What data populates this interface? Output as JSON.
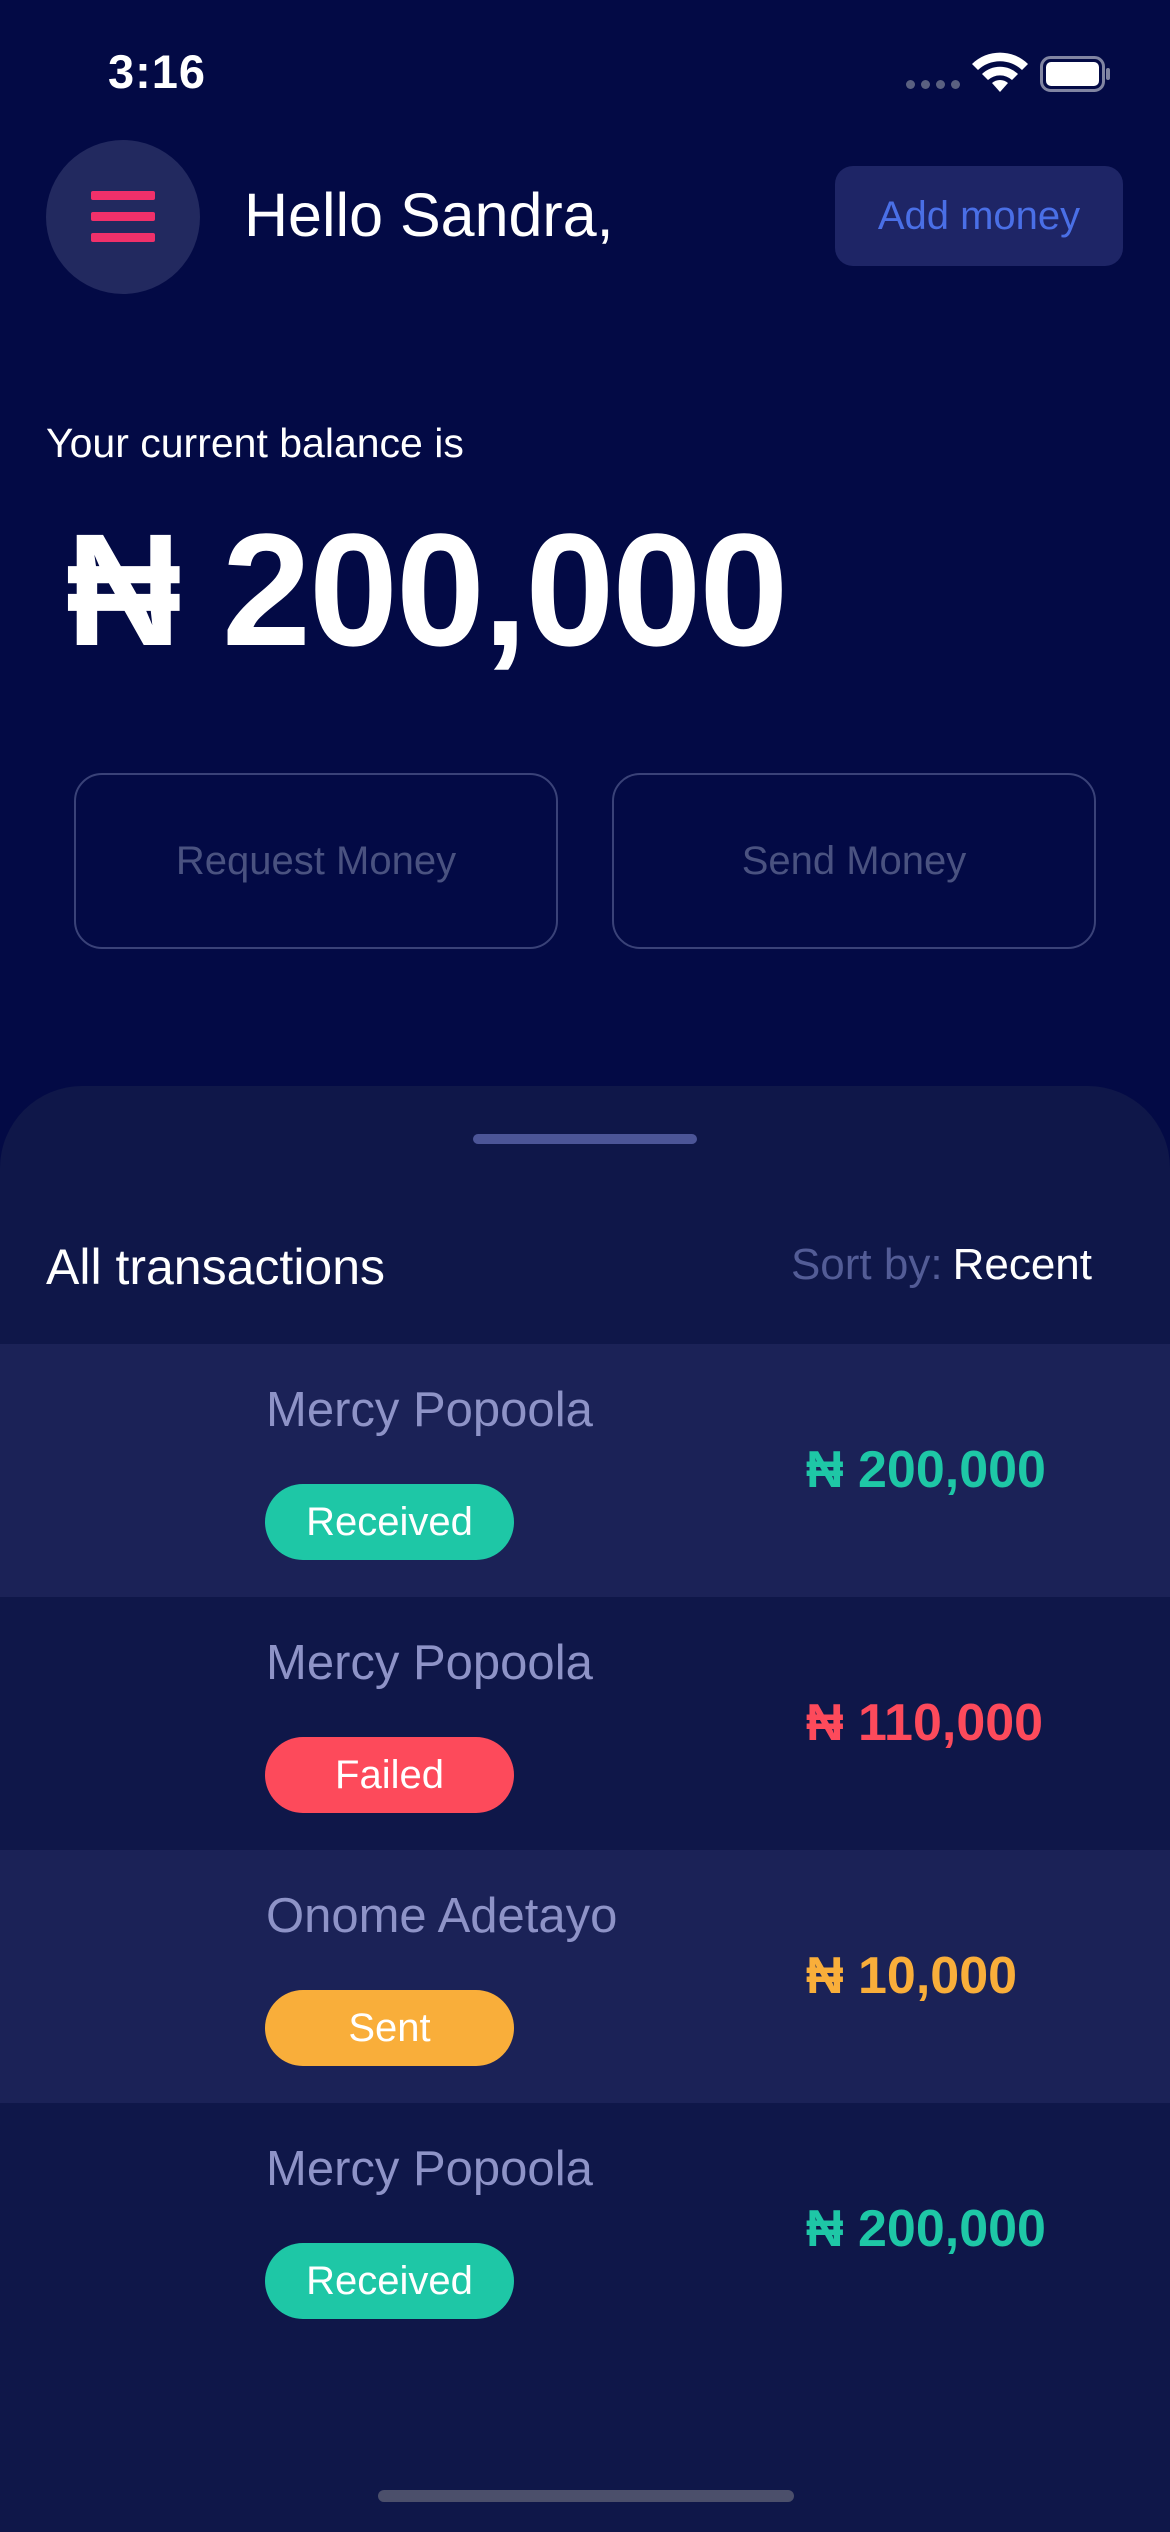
{
  "status_bar": {
    "time": "3:16"
  },
  "header": {
    "greeting": "Hello Sandra,",
    "add_money_label": "Add money"
  },
  "balance": {
    "label": "Your current balance is",
    "amount": "₦ 200,000"
  },
  "actions": {
    "request_label": "Request Money",
    "send_label": "Send Money"
  },
  "transactions": {
    "title": "All transactions",
    "sort_label": "Sort by:",
    "sort_value": "Recent",
    "items": [
      {
        "name": "Mercy Popoola",
        "status": "Received",
        "amount": "₦ 200,000"
      },
      {
        "name": "Mercy Popoola",
        "status": "Failed",
        "amount": "₦ 110,000"
      },
      {
        "name": "Onome Adetayo",
        "status": "Sent",
        "amount": "₦ 10,000"
      },
      {
        "name": "Mercy Popoola",
        "status": "Received",
        "amount": "₦ 200,000"
      }
    ]
  },
  "colors": {
    "background": "#030a45",
    "sheet": "#0f1749",
    "accent_pink": "#f0306a",
    "received": "#1ec7a6",
    "failed": "#fd4a5b",
    "sent": "#f9ae3a",
    "add_money_text": "#4a6fe6"
  },
  "icons": {
    "menu": "hamburger-menu-icon",
    "wifi": "wifi-icon",
    "battery": "battery-icon",
    "signal": "cellular-signal-icon"
  }
}
